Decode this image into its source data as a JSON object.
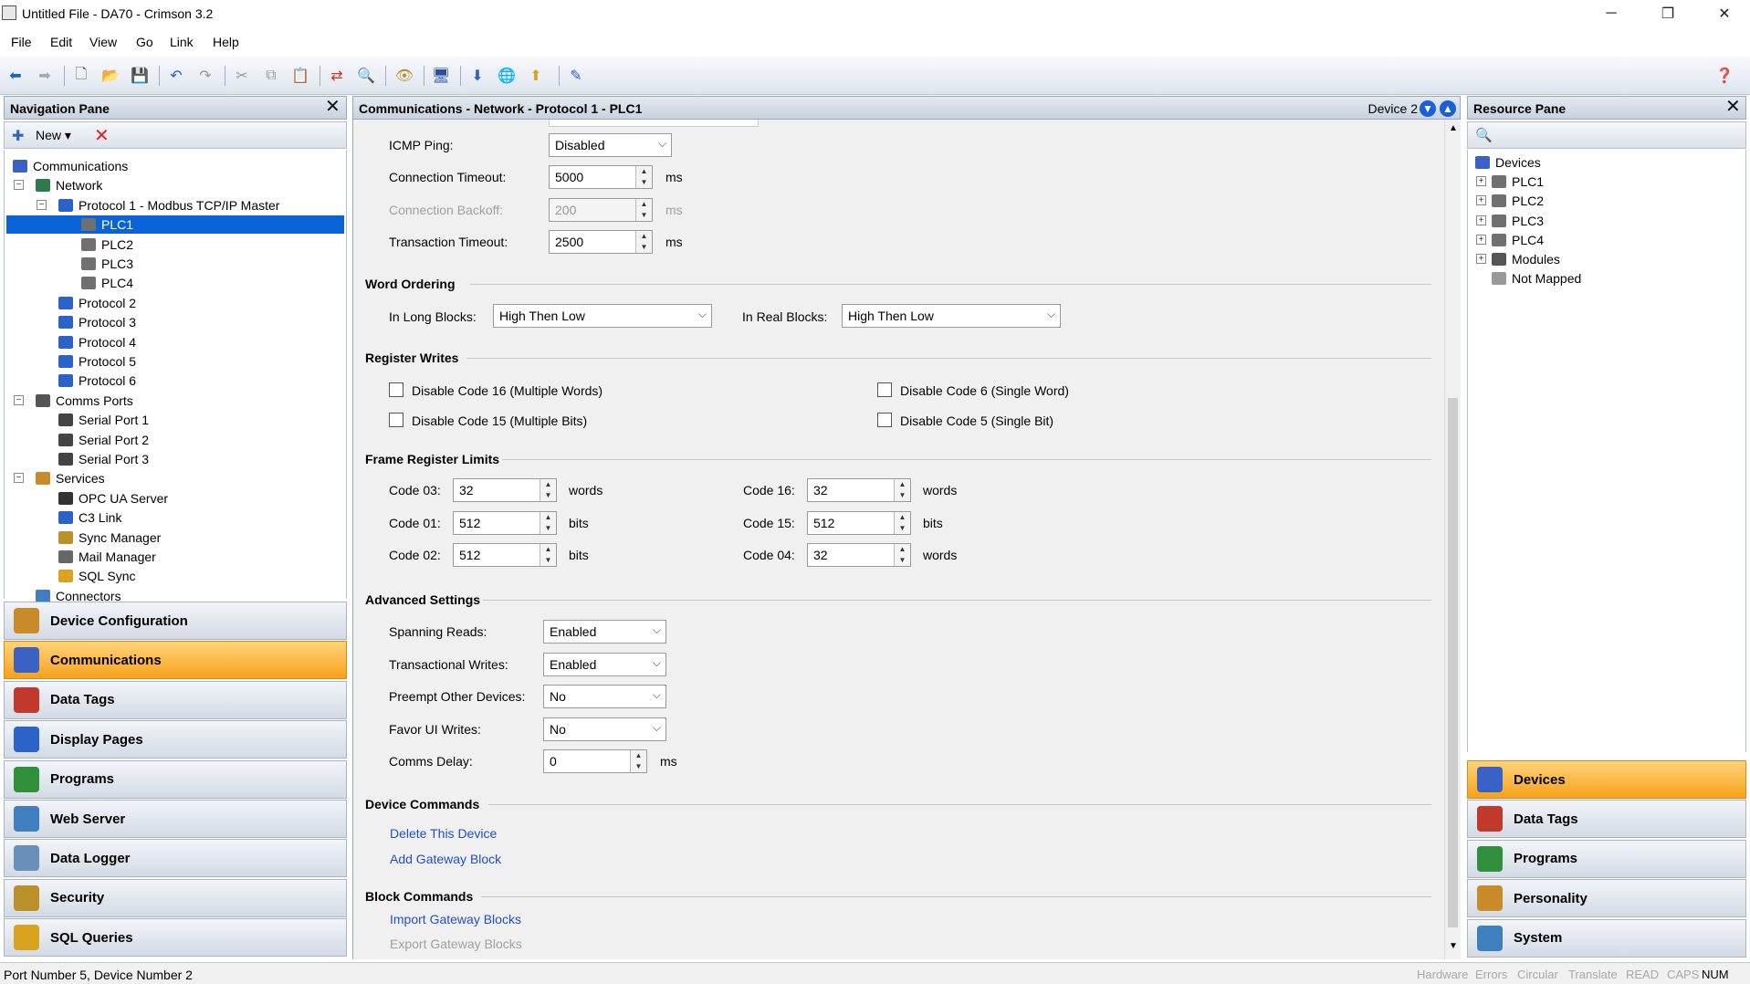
{
  "window": {
    "title": "Untitled File - DA70 - Crimson 3.2",
    "min": "─",
    "restore": "❐",
    "close": "✕"
  },
  "menu": [
    "File",
    "Edit",
    "View",
    "Go",
    "Link",
    "Help"
  ],
  "nav_pane": {
    "title": "Navigation Pane",
    "new_label": "New",
    "tree": [
      {
        "label": "Communications",
        "level": 0,
        "icon": "communications-icon",
        "exp": ""
      },
      {
        "label": "Network",
        "level": 1,
        "icon": "network-icon",
        "exp": "−"
      },
      {
        "label": "Protocol 1 - Modbus TCP/IP Master",
        "level": 2,
        "icon": "protocol-icon",
        "exp": "−"
      },
      {
        "label": "PLC1",
        "level": 3,
        "icon": "plc-icon",
        "exp": "",
        "selected": true
      },
      {
        "label": "PLC2",
        "level": 3,
        "icon": "plc-icon",
        "exp": ""
      },
      {
        "label": "PLC3",
        "level": 3,
        "icon": "plc-icon",
        "exp": ""
      },
      {
        "label": "PLC4",
        "level": 3,
        "icon": "plc-icon",
        "exp": ""
      },
      {
        "label": "Protocol 2",
        "level": 2,
        "icon": "protocol-icon",
        "exp": ""
      },
      {
        "label": "Protocol 3",
        "level": 2,
        "icon": "protocol-icon",
        "exp": ""
      },
      {
        "label": "Protocol 4",
        "level": 2,
        "icon": "protocol-icon",
        "exp": ""
      },
      {
        "label": "Protocol 5",
        "level": 2,
        "icon": "protocol-icon",
        "exp": ""
      },
      {
        "label": "Protocol 6",
        "level": 2,
        "icon": "protocol-icon",
        "exp": ""
      },
      {
        "label": "Comms Ports",
        "level": 1,
        "icon": "comms-ports-icon",
        "exp": "−"
      },
      {
        "label": "Serial Port 1",
        "level": 2,
        "icon": "serial-port-icon",
        "exp": ""
      },
      {
        "label": "Serial Port 2",
        "level": 2,
        "icon": "serial-port-icon",
        "exp": ""
      },
      {
        "label": "Serial Port 3",
        "level": 2,
        "icon": "serial-port-icon",
        "exp": ""
      },
      {
        "label": "Services",
        "level": 1,
        "icon": "services-icon",
        "exp": "−"
      },
      {
        "label": "OPC UA Server",
        "level": 2,
        "icon": "opc-icon",
        "exp": ""
      },
      {
        "label": "C3 Link",
        "level": 2,
        "icon": "link-icon",
        "exp": ""
      },
      {
        "label": "Sync Manager",
        "level": 2,
        "icon": "sync-icon",
        "exp": ""
      },
      {
        "label": "Mail Manager",
        "level": 2,
        "icon": "mail-icon",
        "exp": ""
      },
      {
        "label": "SQL Sync",
        "level": 2,
        "icon": "sql-sync-icon",
        "exp": ""
      },
      {
        "label": "Connectors",
        "level": 1,
        "icon": "connectors-icon",
        "exp": ""
      }
    ],
    "buttons": [
      {
        "label": "Device Configuration",
        "icon": "device-config-icon",
        "color": "#c98b2a"
      },
      {
        "label": "Communications",
        "icon": "communications-icon",
        "color": "#3a62c4",
        "active": true
      },
      {
        "label": "Data Tags",
        "icon": "data-tags-icon",
        "color": "#c0392b"
      },
      {
        "label": "Display Pages",
        "icon": "display-pages-icon",
        "color": "#2b63c9"
      },
      {
        "label": "Programs",
        "icon": "programs-icon",
        "color": "#2f8f3a"
      },
      {
        "label": "Web Server",
        "icon": "web-server-icon",
        "color": "#3f7fbf"
      },
      {
        "label": "Data Logger",
        "icon": "data-logger-icon",
        "color": "#6a8fb8"
      },
      {
        "label": "Security",
        "icon": "security-icon",
        "color": "#b8912a"
      },
      {
        "label": "SQL Queries",
        "icon": "sql-queries-icon",
        "color": "#d9a21f"
      }
    ]
  },
  "center": {
    "title": "Communications - Network - Protocol 1 - PLC1",
    "device_label": "Device 2",
    "icmp_ping": {
      "label": "ICMP Ping:",
      "value": "Disabled"
    },
    "conn_timeout": {
      "label": "Connection Timeout:",
      "value": "5000",
      "unit": "ms"
    },
    "conn_backoff": {
      "label": "Connection Backoff:",
      "value": "200",
      "unit": "ms"
    },
    "trans_timeout": {
      "label": "Transaction Timeout:",
      "value": "2500",
      "unit": "ms"
    },
    "word_ordering": {
      "title": "Word Ordering",
      "long_label": "In Long Blocks:",
      "long_value": "High Then Low",
      "real_label": "In Real Blocks:",
      "real_value": "High Then Low"
    },
    "register_writes": {
      "title": "Register Writes",
      "c16": "Disable Code 16 (Multiple Words)",
      "c15": "Disable Code 15 (Multiple Bits)",
      "c6": "Disable Code 6 (Single Word)",
      "c5": "Disable Code 5 (Single Bit)"
    },
    "frame_limits": {
      "title": "Frame Register Limits",
      "rows": [
        {
          "label": "Code 03:",
          "value": "32",
          "unit": "words"
        },
        {
          "label": "Code 01:",
          "value": "512",
          "unit": "bits"
        },
        {
          "label": "Code 02:",
          "value": "512",
          "unit": "bits"
        },
        {
          "label": "Code 16:",
          "value": "32",
          "unit": "words"
        },
        {
          "label": "Code 15:",
          "value": "512",
          "unit": "bits"
        },
        {
          "label": "Code 04:",
          "value": "32",
          "unit": "words"
        }
      ]
    },
    "advanced": {
      "title": "Advanced Settings",
      "spanning": {
        "label": "Spanning Reads:",
        "value": "Enabled"
      },
      "transactional": {
        "label": "Transactional Writes:",
        "value": "Enabled"
      },
      "preempt": {
        "label": "Preempt Other Devices:",
        "value": "No"
      },
      "favor": {
        "label": "Favor UI Writes:",
        "value": "No"
      },
      "delay": {
        "label": "Comms Delay:",
        "value": "0",
        "unit": "ms"
      }
    },
    "device_commands": {
      "title": "Device Commands",
      "delete": "Delete This Device",
      "add_gateway": "Add Gateway Block"
    },
    "block_commands": {
      "title": "Block Commands",
      "import": "Import Gateway Blocks",
      "export": "Export Gateway Blocks"
    }
  },
  "resource_pane": {
    "title": "Resource Pane",
    "tree": [
      {
        "label": "Devices",
        "level": 0,
        "icon": "devices-icon",
        "exp": ""
      },
      {
        "label": "PLC1",
        "level": 1,
        "icon": "plc-icon",
        "exp": "+"
      },
      {
        "label": "PLC2",
        "level": 1,
        "icon": "plc-icon",
        "exp": "+"
      },
      {
        "label": "PLC3",
        "level": 1,
        "icon": "plc-icon",
        "exp": "+"
      },
      {
        "label": "PLC4",
        "level": 1,
        "icon": "plc-icon",
        "exp": "+"
      },
      {
        "label": "Modules",
        "level": 1,
        "icon": "modules-icon",
        "exp": "+"
      },
      {
        "label": "Not Mapped",
        "level": 1,
        "icon": "not-mapped-icon",
        "exp": ""
      }
    ],
    "buttons": [
      {
        "label": "Devices",
        "icon": "devices-icon",
        "color": "#3a62c4",
        "active": true
      },
      {
        "label": "Data Tags",
        "icon": "data-tags-icon",
        "color": "#c0392b"
      },
      {
        "label": "Programs",
        "icon": "programs-icon",
        "color": "#2f8f3a"
      },
      {
        "label": "Personality",
        "icon": "personality-icon",
        "color": "#c98b2a"
      },
      {
        "label": "System",
        "icon": "system-icon",
        "color": "#3f7fbf"
      }
    ]
  },
  "status": {
    "text": "Port Number 5, Device Number 2",
    "indicators": [
      {
        "label": "Hardware",
        "on": false
      },
      {
        "label": "Errors",
        "on": false
      },
      {
        "label": "Circular",
        "on": false
      },
      {
        "label": "Translate",
        "on": false
      },
      {
        "label": "READ",
        "on": false
      },
      {
        "label": "CAPS",
        "on": false
      },
      {
        "label": "NUM",
        "on": true
      }
    ]
  }
}
